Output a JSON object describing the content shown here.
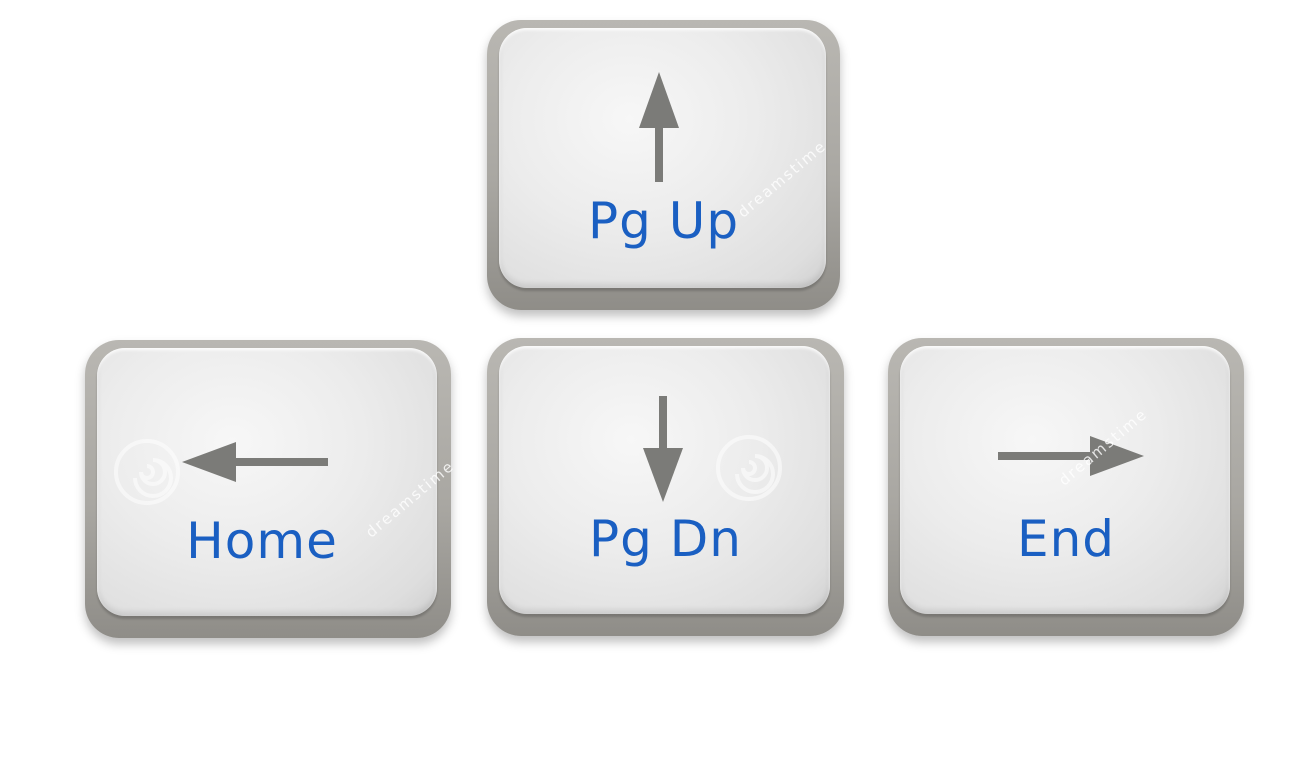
{
  "keys": {
    "pgup": {
      "label": "Pg Up",
      "arrow": "up-arrow-icon"
    },
    "home": {
      "label": "Home",
      "arrow": "left-arrow-icon"
    },
    "pgdn": {
      "label": "Pg Dn",
      "arrow": "down-arrow-icon"
    },
    "end": {
      "label": "End",
      "arrow": "right-arrow-icon"
    }
  },
  "watermark": {
    "text": "dreamstime"
  },
  "colors": {
    "label": "#1a5fc2",
    "arrow": "#7b7b78",
    "keycap": "#e9e9e9",
    "background": "#ffffff"
  }
}
